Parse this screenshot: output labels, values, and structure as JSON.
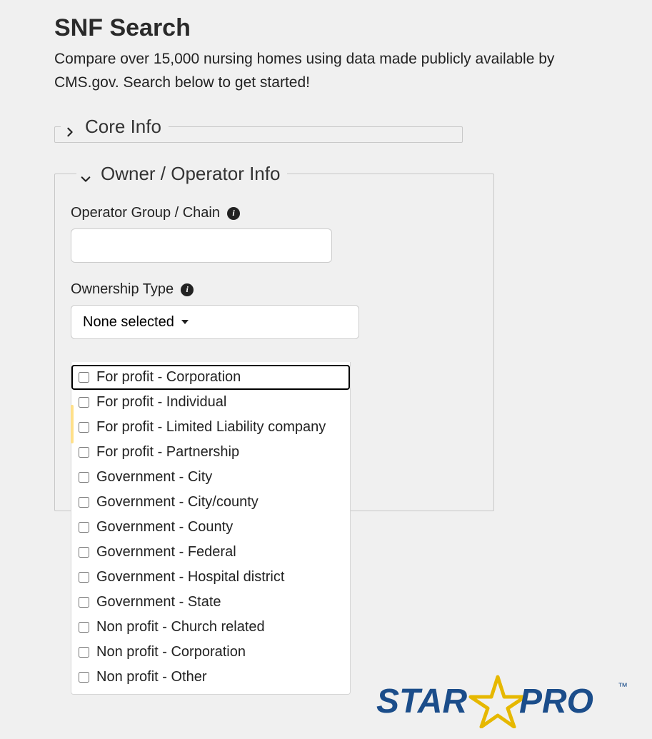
{
  "page_title": "SNF Search",
  "intro_before_link": "Compare over 15,000 nursing homes using data made publicly available by ",
  "intro_link": "CMS.gov",
  "intro_after_link": ". Search below to get started!",
  "sections": {
    "core_info": {
      "title": "Core Info"
    },
    "owner_info": {
      "title": "Owner / Operator Info",
      "operator_label": "Operator Group / Chain",
      "operator_value": "",
      "ownership_label": "Ownership Type",
      "ownership_selected_label": "None selected",
      "ownership_options": [
        "For profit - Corporation",
        "For profit - Individual",
        "For profit - Limited Liability company",
        "For profit - Partnership",
        "Government - City",
        "Government - City/county",
        "Government - County",
        "Government - Federal",
        "Government - Hospital district",
        "Government - State",
        "Non profit - Church related",
        "Non profit - Corporation",
        "Non profit - Other"
      ]
    }
  },
  "logo_text": {
    "star": "STAR",
    "pro": "PRO",
    "tm": "™"
  }
}
